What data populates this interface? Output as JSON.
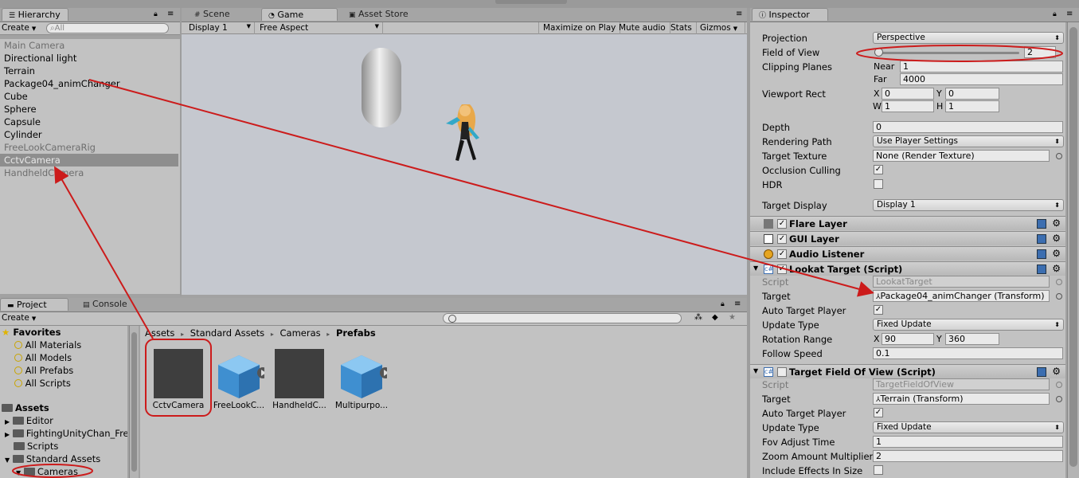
{
  "hierarchy": {
    "tab": "Hierarchy",
    "create": "Create",
    "search_placeholder": "All",
    "items": [
      {
        "label": "Main Camera",
        "state": "grey"
      },
      {
        "label": "Directional light",
        "state": "normal"
      },
      {
        "label": "Terrain",
        "state": "normal"
      },
      {
        "label": "Package04_animChanger",
        "state": "normal"
      },
      {
        "label": "Cube",
        "state": "normal"
      },
      {
        "label": "Sphere",
        "state": "normal"
      },
      {
        "label": "Capsule",
        "state": "normal"
      },
      {
        "label": "Cylinder",
        "state": "normal"
      },
      {
        "label": "FreeLookCameraRig",
        "state": "grey"
      },
      {
        "label": "CctvCamera",
        "state": "selected"
      },
      {
        "label": "HandheldCamera",
        "state": "grey"
      }
    ]
  },
  "scene_tabs": {
    "scene": "Scene",
    "game": "Game",
    "asset_store": "Asset Store"
  },
  "game_toolbar": {
    "display": "Display 1",
    "aspect": "Free Aspect",
    "maximize": "Maximize on Play",
    "mute": "Mute audio",
    "stats": "Stats",
    "gizmos": "Gizmos"
  },
  "project": {
    "tab": "Project",
    "console_tab": "Console",
    "create": "Create",
    "favorites_label": "Favorites",
    "favorites": [
      "All Materials",
      "All Models",
      "All Prefabs",
      "All Scripts"
    ],
    "assets_label": "Assets",
    "folders": [
      "Editor",
      "FightingUnityChan_Fre",
      "Scripts",
      "Standard Assets",
      "Cameras"
    ],
    "breadcrumb": [
      "Assets",
      "Standard Assets",
      "Cameras",
      "Prefabs"
    ],
    "items": [
      "CctvCamera",
      "FreeLookC...",
      "HandheldC...",
      "Multipurpo..."
    ]
  },
  "inspector": {
    "tab": "Inspector",
    "camera": {
      "projection_label": "Projection",
      "projection_value": "Perspective",
      "fov_label": "Field of View",
      "fov_value": "2",
      "fov_fraction": 0.01,
      "clipping_label": "Clipping Planes",
      "near_label": "Near",
      "near_value": "1",
      "far_label": "Far",
      "far_value": "4000",
      "viewport_label": "Viewport Rect",
      "vx_label": "X",
      "vx": "0",
      "vy_label": "Y",
      "vy": "0",
      "vw_label": "W",
      "vw": "1",
      "vh_label": "H",
      "vh": "1",
      "depth_label": "Depth",
      "depth_value": "0",
      "rendering_path_label": "Rendering Path",
      "rendering_path_value": "Use Player Settings",
      "target_texture_label": "Target Texture",
      "target_texture_value": "None (Render Texture)",
      "occlusion_label": "Occlusion Culling",
      "occlusion_checked": true,
      "hdr_label": "HDR",
      "hdr_checked": false,
      "target_display_label": "Target Display",
      "target_display_value": "Display 1"
    },
    "flare_layer": "Flare Layer",
    "gui_layer": "GUI Layer",
    "audio_listener": "Audio Listener",
    "lookat": {
      "title": "Lookat Target (Script)",
      "script_label": "Script",
      "script_value": "LookatTarget",
      "target_label": "Target",
      "target_value": "Package04_animChanger (Transform)",
      "auto_label": "Auto Target Player",
      "auto_checked": true,
      "update_label": "Update Type",
      "update_value": "Fixed Update",
      "rotation_label": "Rotation Range",
      "rx_label": "X",
      "rx": "90",
      "ry_label": "Y",
      "ry": "360",
      "follow_label": "Follow Speed",
      "follow_value": "0.1"
    },
    "tfov": {
      "title": "Target Field Of View (Script)",
      "script_label": "Script",
      "script_value": "TargetFieldOfView",
      "target_label": "Target",
      "target_value": "Terrain (Transform)",
      "auto_label": "Auto Target Player",
      "auto_checked": true,
      "update_label": "Update Type",
      "update_value": "Fixed Update",
      "fov_adjust_label": "Fov Adjust Time",
      "fov_adjust_value": "1",
      "zoom_label": "Zoom Amount Multiplier",
      "zoom_value": "2",
      "effects_label": "Include Effects In Size",
      "effects_checked": false
    }
  },
  "colors": {
    "annotation": "#cc1b1b",
    "selection": "#8e8e8e",
    "panel": "#c2c2c2",
    "game_bg": "#c5c8cf"
  }
}
